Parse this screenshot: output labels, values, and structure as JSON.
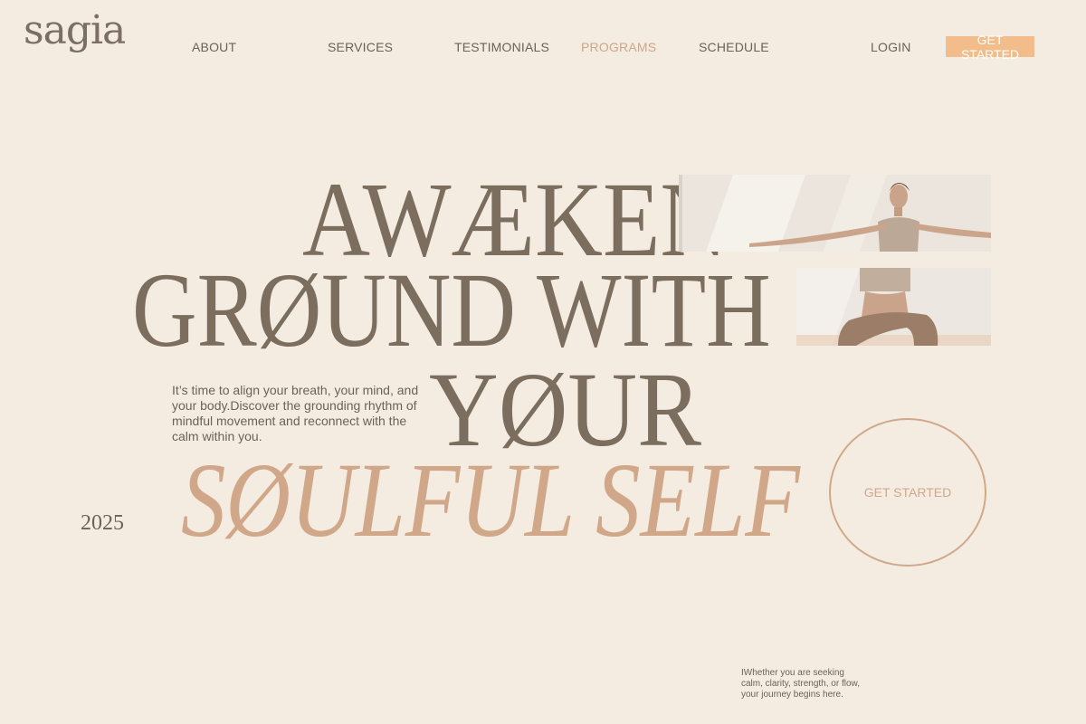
{
  "brand": {
    "logo_text": "sagia"
  },
  "nav": {
    "items": [
      {
        "label": "ABOUT"
      },
      {
        "label": "SERVICES"
      },
      {
        "label": "TESTIMONIALS"
      },
      {
        "label": "PROGRAMS",
        "active": true
      },
      {
        "label": "SCHEDULE"
      }
    ],
    "login_label": "LOGIN",
    "cta_label": "GET STARTED"
  },
  "hero": {
    "line1": "AWÆKEN",
    "line2": "GRØUND WITH",
    "line3": "YØUR",
    "line4": "SØULFUL SELF",
    "intro": "It’s time to align your breath, your mind, and your body.Discover the grounding rhythm of mindful movement and reconnect with the calm within you.",
    "year": "2025",
    "circle_cta": "GET STARTED",
    "footnote": "IWhether you are seeking calm, clarity, strength, or flow, your journey begins here."
  },
  "colors": {
    "background": "#f4ebe1",
    "headline": "#7b6e5f",
    "accent": "#d0a889",
    "cta_fill": "#f2bd8a"
  }
}
